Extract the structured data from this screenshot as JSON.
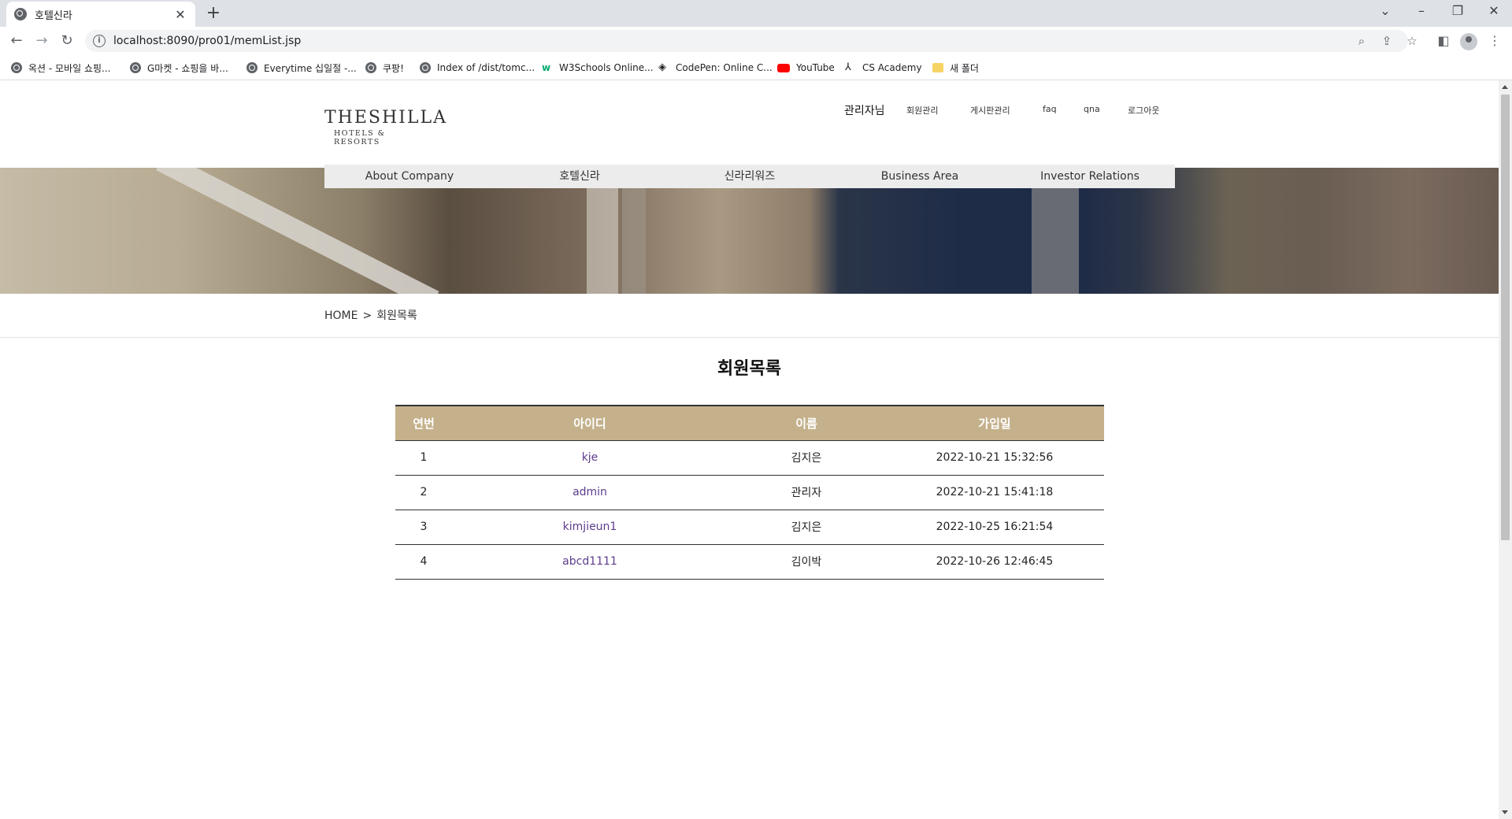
{
  "browser": {
    "tab_title": "호텔신라",
    "url": "localhost:8090/pro01/memList.jsp",
    "bookmarks": [
      {
        "label": "옥션 - 모바일 쇼핑...",
        "icon": "globe-icon"
      },
      {
        "label": "G마켓 - 쇼핑을 바...",
        "icon": "globe-icon"
      },
      {
        "label": "Everytime 십일절 -...",
        "icon": "globe-icon"
      },
      {
        "label": "쿠팡!",
        "icon": "globe-icon"
      },
      {
        "label": "Index of /dist/tomc...",
        "icon": "globe-icon"
      },
      {
        "label": "W3Schools Online...",
        "icon": "w3schools-icon"
      },
      {
        "label": "CodePen: Online C...",
        "icon": "codepen-icon"
      },
      {
        "label": "YouTube",
        "icon": "youtube-icon"
      },
      {
        "label": "CS Academy",
        "icon": "cs-academy-icon"
      },
      {
        "label": "새 폴더",
        "icon": "folder-icon"
      }
    ]
  },
  "header": {
    "logo_main": "THESHILLA",
    "logo_sub": "HOTELS & RESORTS",
    "admin_label": "관리자님",
    "util_links": [
      "회원관리",
      "게시판관리",
      "faq",
      "qna",
      "로그아웃"
    ]
  },
  "gnb": [
    "About Company",
    "호텔신라",
    "신라리워즈",
    "Business Area",
    "Investor Relations"
  ],
  "breadcrumb": {
    "home": "HOME",
    "separator": ">",
    "current": "회원목록"
  },
  "main": {
    "title": "회원목록",
    "table": {
      "columns": [
        "연번",
        "아이디",
        "이름",
        "가입일"
      ],
      "rows": [
        {
          "no": "1",
          "id": "kje",
          "name": "김지은",
          "date": "2022-10-21 15:32:56"
        },
        {
          "no": "2",
          "id": "admin",
          "name": "관리자",
          "date": "2022-10-21 15:41:18"
        },
        {
          "no": "3",
          "id": "kimjieun1",
          "name": "김지은",
          "date": "2022-10-25 16:21:54"
        },
        {
          "no": "4",
          "id": "abcd1111",
          "name": "김이박",
          "date": "2022-10-26 12:46:45"
        }
      ]
    }
  },
  "colors": {
    "table_header_bg": "#c4b18b",
    "gnb_bg": "#ececec",
    "id_link": "#5c3c8c"
  }
}
